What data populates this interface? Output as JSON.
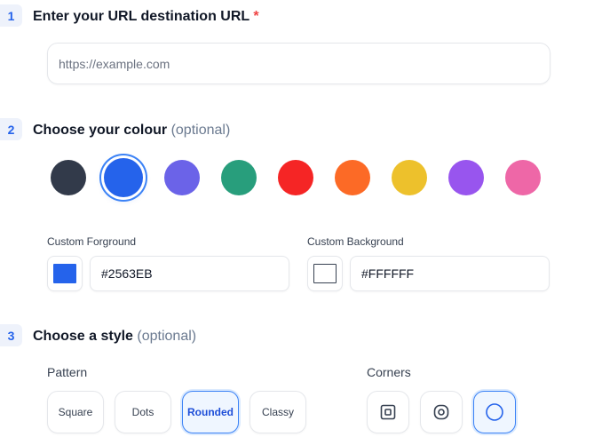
{
  "steps": [
    {
      "number": "1",
      "title": "Enter your URL destination URL",
      "required_mark": "*"
    },
    {
      "number": "2",
      "title": "Choose your colour",
      "optional": "(optional)"
    },
    {
      "number": "3",
      "title": "Choose a style",
      "optional": "(optional)"
    }
  ],
  "url_input": {
    "placeholder": "https://example.com",
    "value": ""
  },
  "swatches": [
    {
      "color": "#323a4a",
      "selected": false
    },
    {
      "color": "#2563eb",
      "selected": true
    },
    {
      "color": "#6b63e8",
      "selected": false
    },
    {
      "color": "#289e7c",
      "selected": false
    },
    {
      "color": "#f52525",
      "selected": false
    },
    {
      "color": "#fc6a26",
      "selected": false
    },
    {
      "color": "#edc12c",
      "selected": false
    },
    {
      "color": "#9855ee",
      "selected": false
    },
    {
      "color": "#ee67a7",
      "selected": false
    }
  ],
  "custom_foreground": {
    "label": "Custom Forground",
    "value": "#2563EB",
    "color": "#2563EB"
  },
  "custom_background": {
    "label": "Custom Background",
    "value": "#FFFFFF",
    "color": "#FFFFFF"
  },
  "pattern": {
    "label": "Pattern",
    "options": [
      "Square",
      "Dots",
      "Rounded",
      "Classy"
    ],
    "selected": "Rounded"
  },
  "corners": {
    "label": "Corners",
    "options": [
      "square-corner-icon",
      "rounded-corner-icon",
      "circle-corner-icon"
    ],
    "selected": "circle-corner-icon"
  },
  "accent_color": "#2563eb"
}
